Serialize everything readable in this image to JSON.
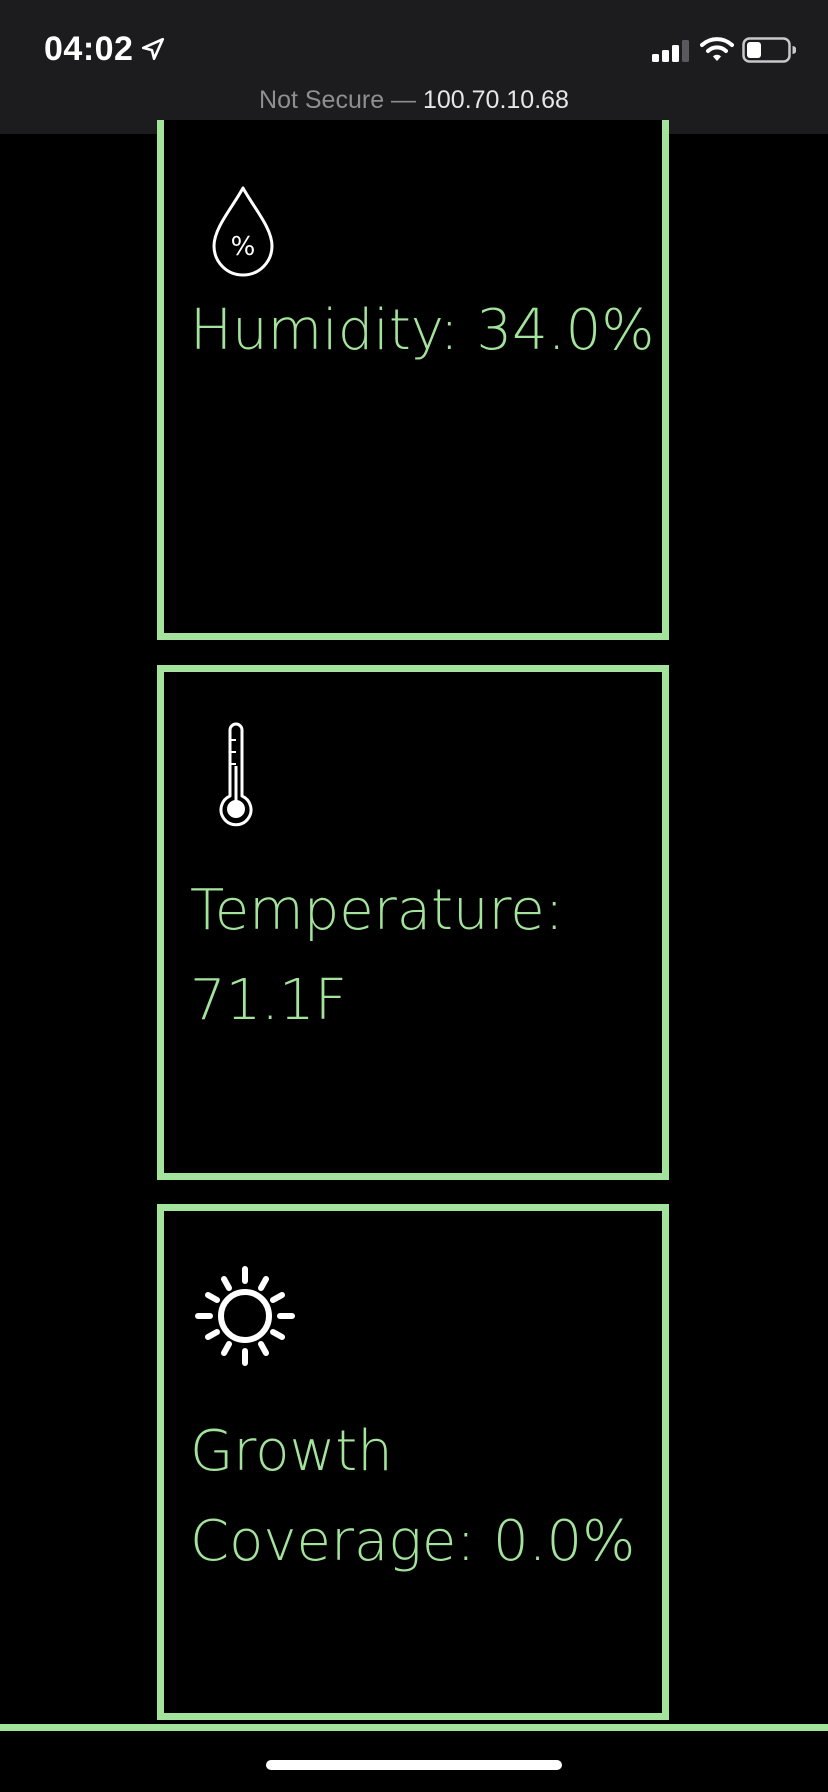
{
  "status_bar": {
    "time": "04:02",
    "icons": [
      "location-arrow-icon",
      "cellular-signal-icon",
      "wifi-icon",
      "battery-icon"
    ]
  },
  "browser": {
    "security_text": "Not Secure — ",
    "host": "100.70.10.68"
  },
  "cards": {
    "humidity": {
      "icon": "humidity-drop-icon",
      "icon_text": "%",
      "label": "Humidity: 34.0%"
    },
    "temperature": {
      "icon": "thermometer-icon",
      "label_line1": "Temperature:",
      "label_line2": "71.1F"
    },
    "growth": {
      "icon": "sun-icon",
      "label_line1": "Growth",
      "label_line2": "Coverage: 0.0%"
    }
  },
  "colors": {
    "accent": "#a3e39b",
    "background": "#000000",
    "status_bar_bg": "#1c1c1e"
  }
}
